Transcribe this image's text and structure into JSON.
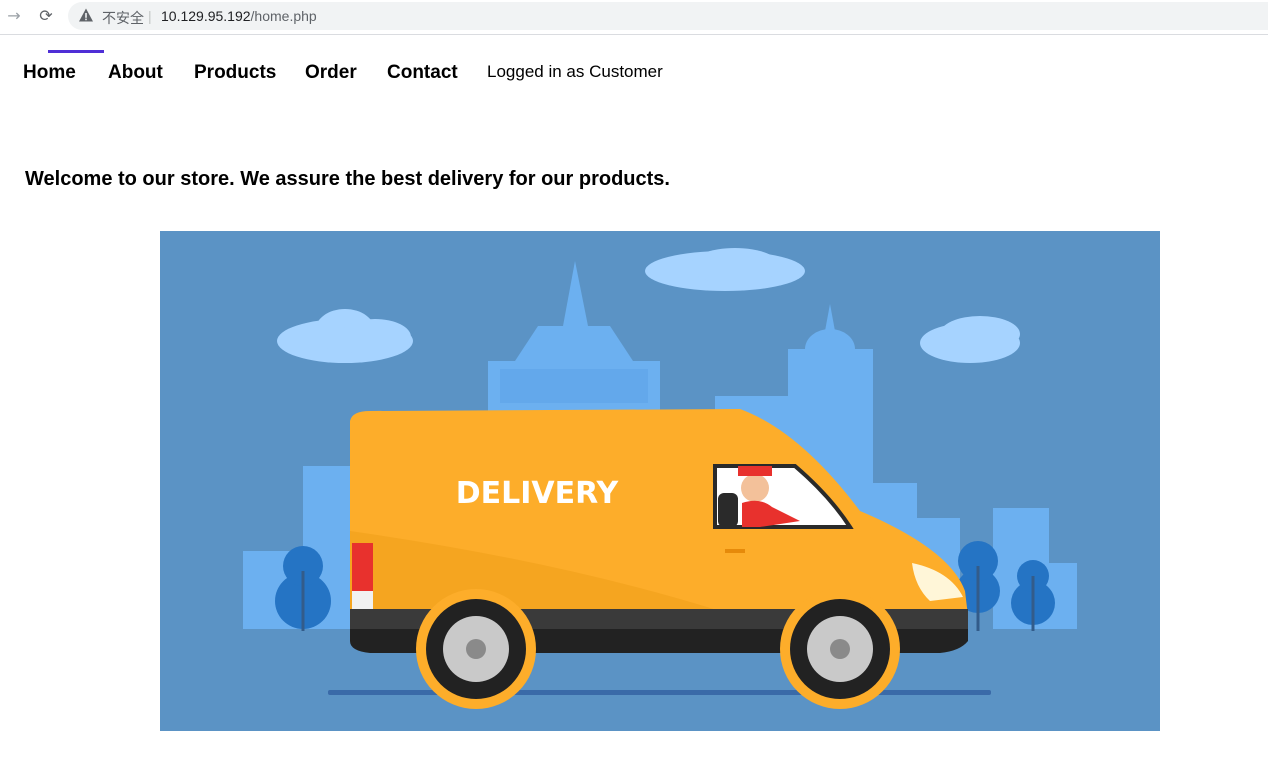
{
  "browser": {
    "insecure_label": "不安全",
    "separator": "|",
    "url_host": "10.129.95.192",
    "url_path": "/home.php"
  },
  "nav": {
    "items": [
      {
        "label": "Home"
      },
      {
        "label": "About"
      },
      {
        "label": "Products"
      },
      {
        "label": "Order"
      },
      {
        "label": "Contact"
      }
    ],
    "login_status": "Logged in as Customer"
  },
  "main": {
    "welcome": "Welcome to our store. We assure the best delivery for our products."
  },
  "hero": {
    "van_text": "DELIVERY"
  },
  "colors": {
    "accent": "#4f2fd6",
    "hero_bg": "#5b93c5",
    "van": "#fdad2a"
  }
}
